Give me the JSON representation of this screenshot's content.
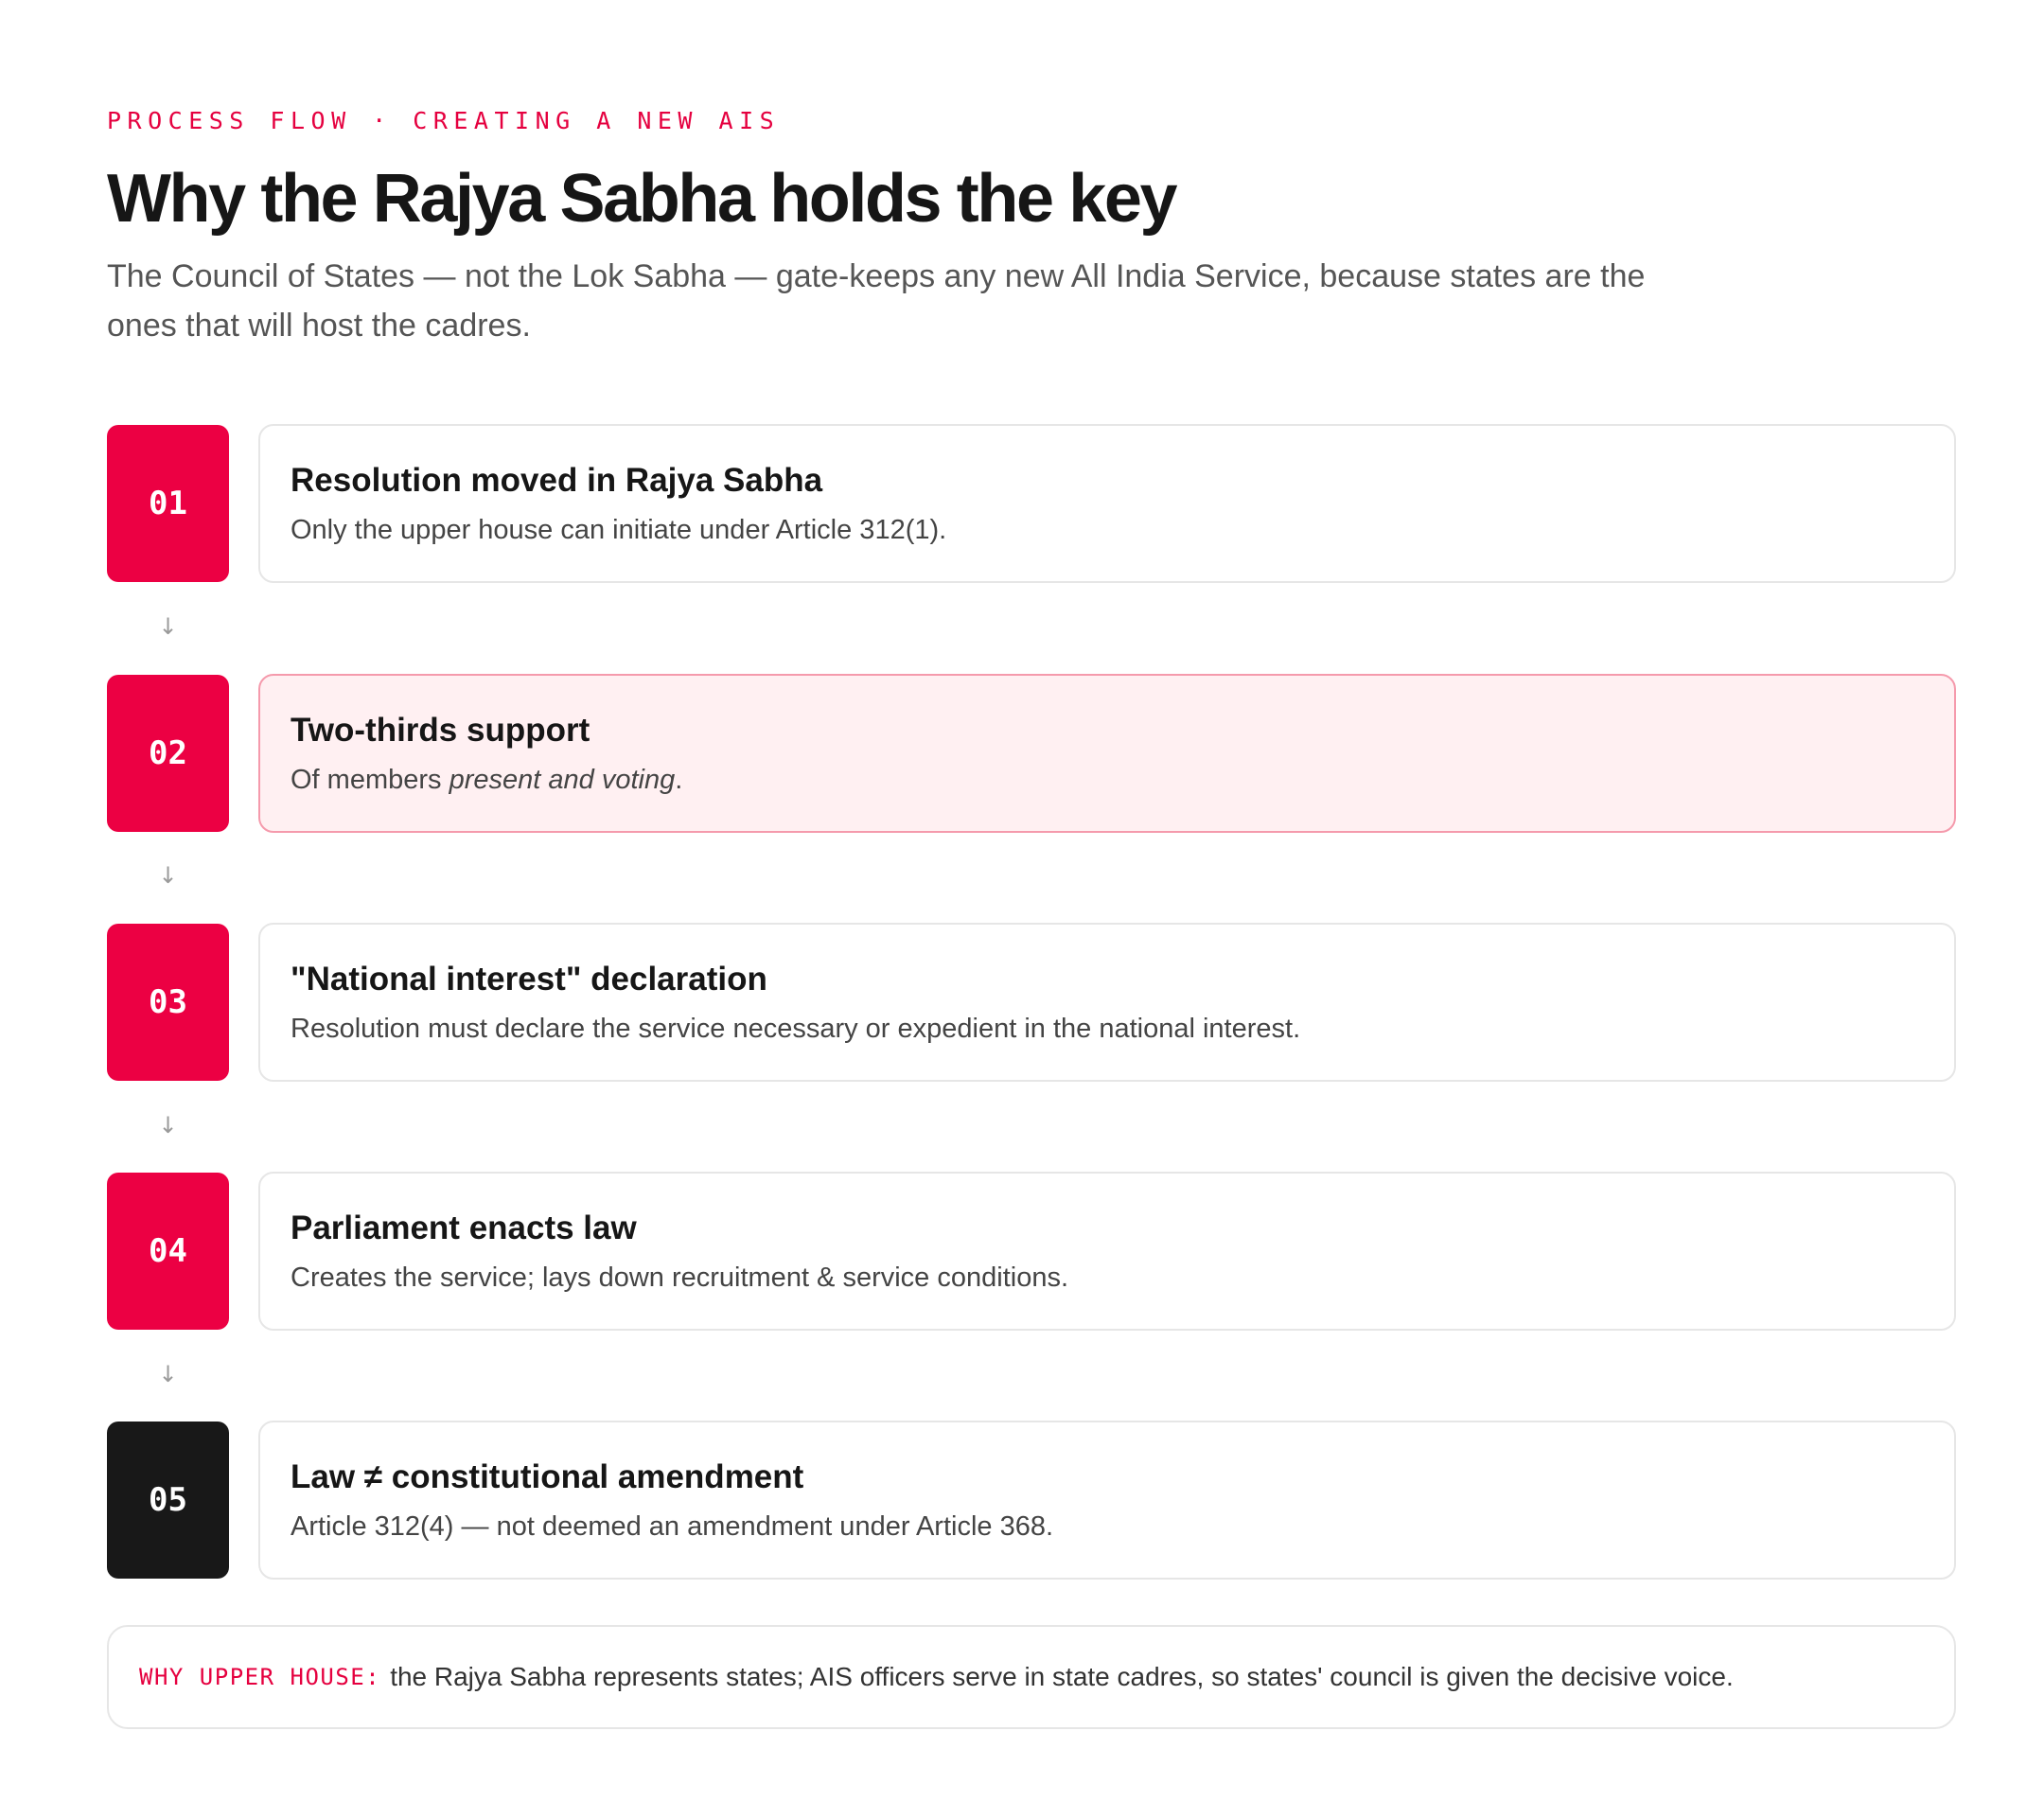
{
  "header": {
    "eyebrow": "PROCESS FLOW · CREATING A NEW AIS",
    "title": "Why the Rajya Sabha holds the key",
    "subtitle": "The Council of States — not the Lok Sabha — gate-keeps any new All India Service, because states are the ones that will host the cadres."
  },
  "steps": [
    {
      "number": "01",
      "title": "Resolution moved in Rajya Sabha",
      "description": "Only the upper house can initiate under Article 312(1).",
      "highlight": false,
      "badge_color": "#ec0043"
    },
    {
      "number": "02",
      "title": "Two-thirds support",
      "description_prefix": "Of members ",
      "description_emphasis": "present and voting",
      "description_suffix": ".",
      "highlight": true,
      "badge_color": "#ec0043"
    },
    {
      "number": "03",
      "title": "\"National interest\" declaration",
      "description": "Resolution must declare the service necessary or expedient in the national interest.",
      "highlight": false,
      "badge_color": "#ec0043"
    },
    {
      "number": "04",
      "title": "Parliament enacts law",
      "description": "Creates the service; lays down recruitment & service conditions.",
      "highlight": false,
      "badge_color": "#ec0043"
    },
    {
      "number": "05",
      "title": "Law ≠ constitutional amendment",
      "description": "Article 312(4) — not deemed an amendment under Article 368.",
      "highlight": false,
      "badge_color": "#181818"
    }
  ],
  "arrow_glyph": "↓",
  "note": {
    "label": "WHY UPPER HOUSE:",
    "text": "the Rajya Sabha represents states; AIS officers serve in state cadres, so states' council is given the decisive voice."
  },
  "colors": {
    "accent": "#ec0043",
    "dark": "#181818",
    "highlight_bg": "#fff0f2",
    "highlight_border": "#f59aac"
  }
}
